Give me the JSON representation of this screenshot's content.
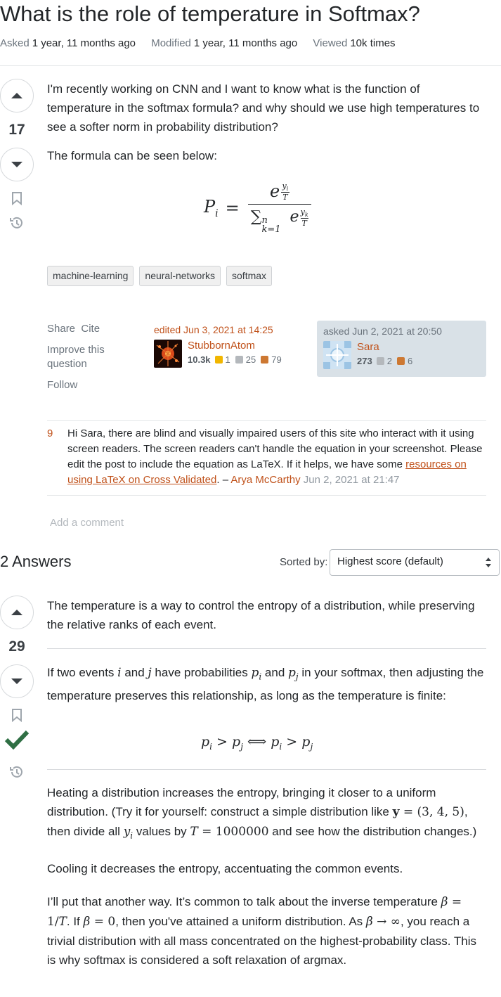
{
  "question": {
    "title": "What is the role of temperature in Softmax?",
    "asked_label": "Asked",
    "asked_value": "1 year, 11 months ago",
    "modified_label": "Modified",
    "modified_value": "1 year, 11 months ago",
    "viewed_label": "Viewed",
    "viewed_value": "10k times",
    "score": "17",
    "body_p1": "I'm recently working on CNN and I want to know what is the function of temperature in the softmax formula? and why should we use high temperatures to see a softer norm in probability distribution?",
    "body_p2": "The formula can be seen below:",
    "formula": {
      "lhs": "P",
      "lhs_sub": "i",
      "eq": "=",
      "num_base": "e",
      "num_exp_num": "y",
      "num_exp_num_sub": "i",
      "num_exp_den": "T",
      "den_sum": "∑",
      "den_sum_sup": "n",
      "den_sum_sub": "k=1",
      "den_base": "e",
      "den_exp_num": "y",
      "den_exp_num_sub": "k",
      "den_exp_den": "T"
    },
    "tags": [
      "machine-learning",
      "neural-networks",
      "softmax"
    ],
    "menu": {
      "share": "Share",
      "cite": "Cite",
      "improve": "Improve this question",
      "follow": "Follow"
    },
    "editor": {
      "when": "edited Jun 3, 2021 at 14:25",
      "name": "StubbornAtom",
      "rep": "10.3k",
      "gold": "1",
      "silver": "25",
      "bronze": "79"
    },
    "owner": {
      "when": "asked Jun 2, 2021 at 20:50",
      "name": "Sara",
      "rep": "273",
      "silver": "2",
      "bronze": "6"
    },
    "comment": {
      "score": "9",
      "text_before": "Hi Sara, there are blind and visually impaired users of this site who interact with it using screen readers. The screen readers can't handle the equation in your screenshot. Please edit the post to include the equation as LaTeX. If it helps, we have some ",
      "link_text": "resources on using LaTeX on Cross Validated",
      "text_after": ". – ",
      "user": "Arya McCarthy",
      "date": " Jun 2, 2021 at 21:47"
    },
    "add_comment": "Add a comment"
  },
  "answers_header": {
    "count_label": "2 Answers",
    "sort_label": "Sorted by:",
    "sort_value": "Highest score (default)"
  },
  "answer": {
    "score": "29",
    "p1": "The temperature is a way to control the entropy of a distribution, while preserving the relative ranks of each event.",
    "p2_a": "If two events ",
    "p2_i": "i",
    "p2_b": " and ",
    "p2_j": "j",
    "p2_c": " have probabilities ",
    "p2_pi": "p",
    "p2_pi_sub": "i",
    "p2_d": " and ",
    "p2_pj": "p",
    "p2_pj_sub": "j",
    "p2_e": " in your softmax, then adjusting the temperature preserves this relationship, as long as the temperature is finite:",
    "eq2_left": "p",
    "eq2_left_sub": "i",
    "eq2_gt": " > ",
    "eq2_mid": "p",
    "eq2_mid_sub": "j",
    "eq2_iff": " ⟺ ",
    "eq2_r1": "p",
    "eq2_r1_sub": "i",
    "eq2_gt2": " > ",
    "eq2_r2": "p",
    "eq2_r2_sub": "j",
    "p3_a": "Heating a distribution increases the entropy, bringing it closer to a uniform distribution. (Try it for yourself: construct a simple distribution like ",
    "p3_y": "y",
    "p3_vec": " = (3, 4, 5)",
    "p3_b": ", then divide all ",
    "p3_yi": "y",
    "p3_yi_sub": "i",
    "p3_c": " values by ",
    "p3_T": "T",
    "p3_Tval": " = 1000000",
    "p3_d": " and see how the distribution changes.)",
    "p4": "Cooling it decreases the entropy, accentuating the common events.",
    "p5_a": "I’ll put that another way. It’s common to talk about the inverse temperature ",
    "p5_beta": "β",
    "p5_beta_def": " = 1/",
    "p5_T": "T",
    "p5_b": ". If ",
    "p5_beta2": "β",
    "p5_zero": " = 0",
    "p5_c": ", then you've attained a uniform distribution. As ",
    "p5_beta3": "β",
    "p5_inf": " → ∞",
    "p5_d": ", you reach a trivial distribution with all mass concentrated on the highest-probability class. This is why softmax is considered a soft relaxation of argmax."
  },
  "colors": {
    "accent": "#c0511a",
    "accepted": "#2f6f44",
    "muted": "#6a737c"
  }
}
